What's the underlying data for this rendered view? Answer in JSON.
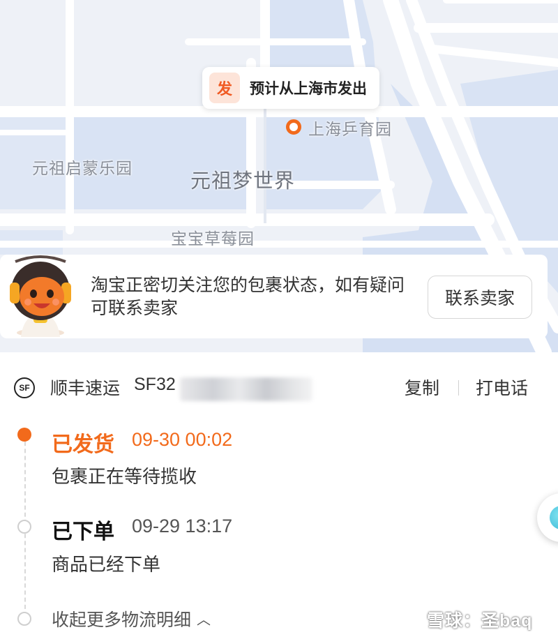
{
  "map": {
    "origin_badge": "发",
    "origin_text": "预计从上海市发出",
    "labels": {
      "pingpong_park": "上海乒育园",
      "qimeng_park": "元祖启蒙乐园",
      "dream_world": "元祖梦世界",
      "strawberry_park": "宝宝草莓园"
    }
  },
  "notice": {
    "text": "淘宝正密切关注您的包裹状态，如有疑问可联系卖家",
    "contact_button": "联系卖家"
  },
  "courier": {
    "logo_text": "SF",
    "name": "顺丰速运",
    "tracking_visible": "SF32",
    "copy_label": "复制",
    "call_label": "打电话"
  },
  "timeline": [
    {
      "status": "已发货",
      "time": "09-30 00:02",
      "desc": "包裹正在等待揽收",
      "active": true
    },
    {
      "status": "已下单",
      "time": "09-29 13:17",
      "desc": "商品已经下单",
      "active": false
    }
  ],
  "collapse_label": "收起更多物流明细",
  "watermark": "雪球：圣baq",
  "colors": {
    "accent": "#f26a1b",
    "map_water": "#d6e2f5",
    "map_land": "#eef1f7"
  }
}
